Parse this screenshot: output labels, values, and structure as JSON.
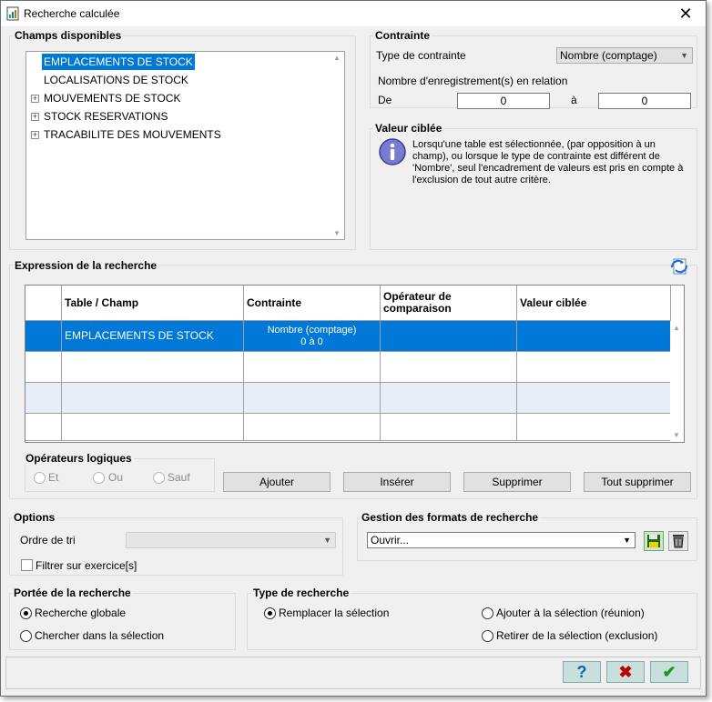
{
  "window": {
    "title": "Recherche calculée",
    "close": "✕"
  },
  "fields": {
    "label": "Champs disponibles",
    "items": [
      {
        "label": "EMPLACEMENTS DE STOCK",
        "expandable": false,
        "selected": true
      },
      {
        "label": "LOCALISATIONS DE STOCK",
        "expandable": false,
        "selected": false
      },
      {
        "label": "MOUVEMENTS DE STOCK",
        "expandable": true,
        "selected": false
      },
      {
        "label": "STOCK RESERVATIONS",
        "expandable": true,
        "selected": false
      },
      {
        "label": "TRACABILITE DES MOUVEMENTS",
        "expandable": true,
        "selected": false
      }
    ],
    "expand_glyph": "+"
  },
  "constraint": {
    "label": "Contrainte",
    "type_label": "Type de contrainte",
    "type_value": "Nombre (comptage)",
    "count_label": "Nombre d'enregistrement(s) en relation",
    "from_label": "De",
    "from_value": "0",
    "to_label": "à",
    "to_value": "0"
  },
  "target": {
    "label": "Valeur ciblée",
    "info_text": "Lorsqu'une table est sélectionnée, (par opposition à un champ), ou lorsque le type de contrainte est différent de 'Nombre', seul l'encadrement de valeurs est pris en compte à l'exclusion de tout autre critère."
  },
  "expression": {
    "label": "Expression de la recherche",
    "headers": [
      "Table / Champ",
      "Contrainte",
      "Opérateur de comparaison",
      "Valeur ciblée"
    ],
    "rows": [
      {
        "table": "EMPLACEMENTS DE STOCK",
        "constraint_line1": "Nombre (comptage)",
        "constraint_line2": "0 à 0",
        "operator": "",
        "value": ""
      }
    ]
  },
  "logic": {
    "label": "Opérateurs logiques",
    "options": [
      "Et",
      "Ou",
      "Sauf"
    ]
  },
  "buttons": {
    "add": "Ajouter",
    "insert": "Insérer",
    "delete": "Supprimer",
    "delete_all": "Tout supprimer"
  },
  "options": {
    "label": "Options",
    "sort_label": "Ordre de tri",
    "sort_value": "",
    "filter_label": "Filtrer sur exercice[s]",
    "filter_checked": false
  },
  "formats": {
    "label": "Gestion des formats de recherche",
    "value": "Ouvrir..."
  },
  "scope": {
    "label": "Portée de la recherche",
    "options": [
      "Recherche globale",
      "Chercher dans la sélection"
    ],
    "selected": 0
  },
  "search_type": {
    "label": "Type de recherche",
    "options": [
      "Remplacer la sélection",
      "Ajouter à la sélection (réunion)",
      "Retirer de la sélection (exclusion)"
    ],
    "selected": 0
  },
  "footer": {
    "help": "?",
    "cancel": "✖",
    "ok": "✔"
  },
  "colors": {
    "selection": "#0078d7",
    "alt_row": "#e8eef8",
    "ok_green": "#1a9a1a",
    "cancel_red": "#c00000",
    "help_blue": "#1a5fb4"
  }
}
